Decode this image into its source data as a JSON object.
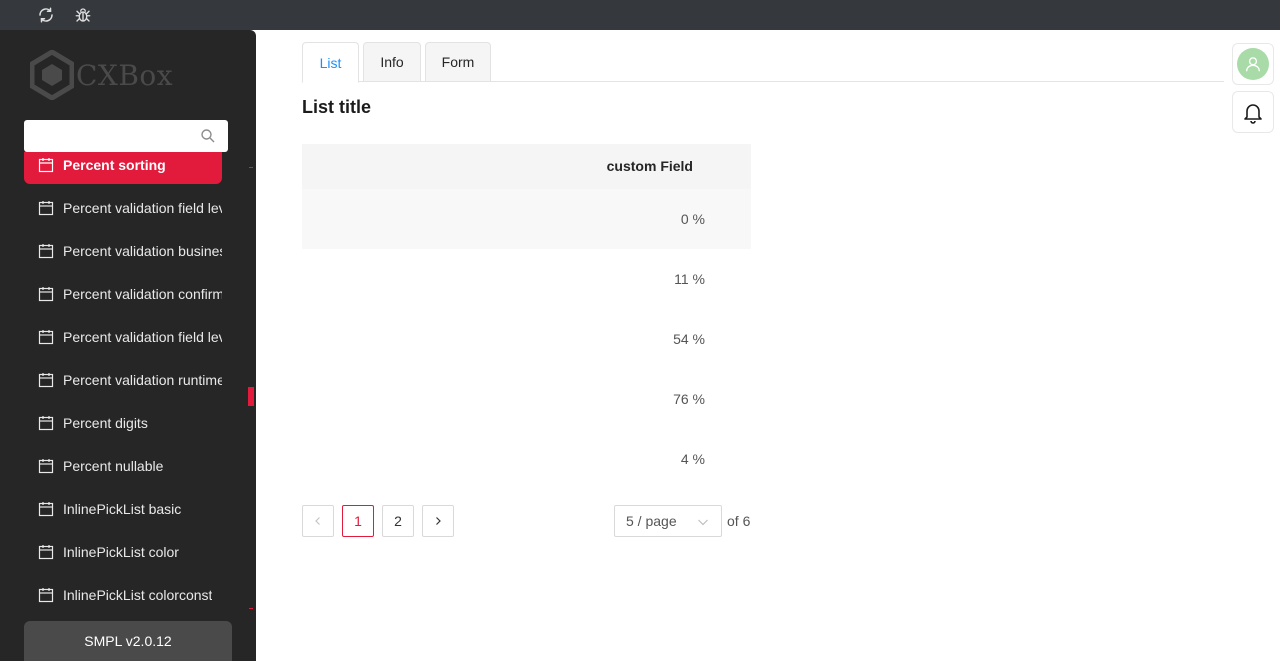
{
  "topbar": {
    "icons": [
      "refresh-icon",
      "bug-icon"
    ]
  },
  "sidebar": {
    "logo_text": "CXBox",
    "search": {
      "value": "",
      "placeholder": ""
    },
    "items": [
      {
        "label": "Percent sorting",
        "active": true
      },
      {
        "label": "Percent validation field level",
        "active": false
      },
      {
        "label": "Percent validation business exception",
        "active": false
      },
      {
        "label": "Percent validation confirm",
        "active": false
      },
      {
        "label": "Percent validation field level",
        "active": false
      },
      {
        "label": "Percent validation runtime",
        "active": false
      },
      {
        "label": "Percent digits",
        "active": false
      },
      {
        "label": "Percent nullable",
        "active": false
      },
      {
        "label": "InlinePickList basic",
        "active": false
      },
      {
        "label": "InlinePickList color",
        "active": false
      },
      {
        "label": "InlinePickList colorconst",
        "active": false
      }
    ],
    "version": "SMPL v2.0.12"
  },
  "tabs": [
    {
      "label": "List",
      "active": true
    },
    {
      "label": "Info",
      "active": false
    },
    {
      "label": "Form",
      "active": false
    }
  ],
  "list_title": "List title",
  "table": {
    "columns": [
      "custom Field"
    ],
    "rows": [
      "0 %",
      "11 %",
      "54 %",
      "76 %",
      "4 %"
    ]
  },
  "pagination": {
    "pages": [
      "1",
      "2"
    ],
    "current": "1",
    "page_size": "5 / page",
    "total": "of 6"
  },
  "colors": {
    "accent": "#e21a3b",
    "tab_active": "#1890ff",
    "sidebar_bg": "#262626",
    "topbar_bg": "#35383d"
  }
}
